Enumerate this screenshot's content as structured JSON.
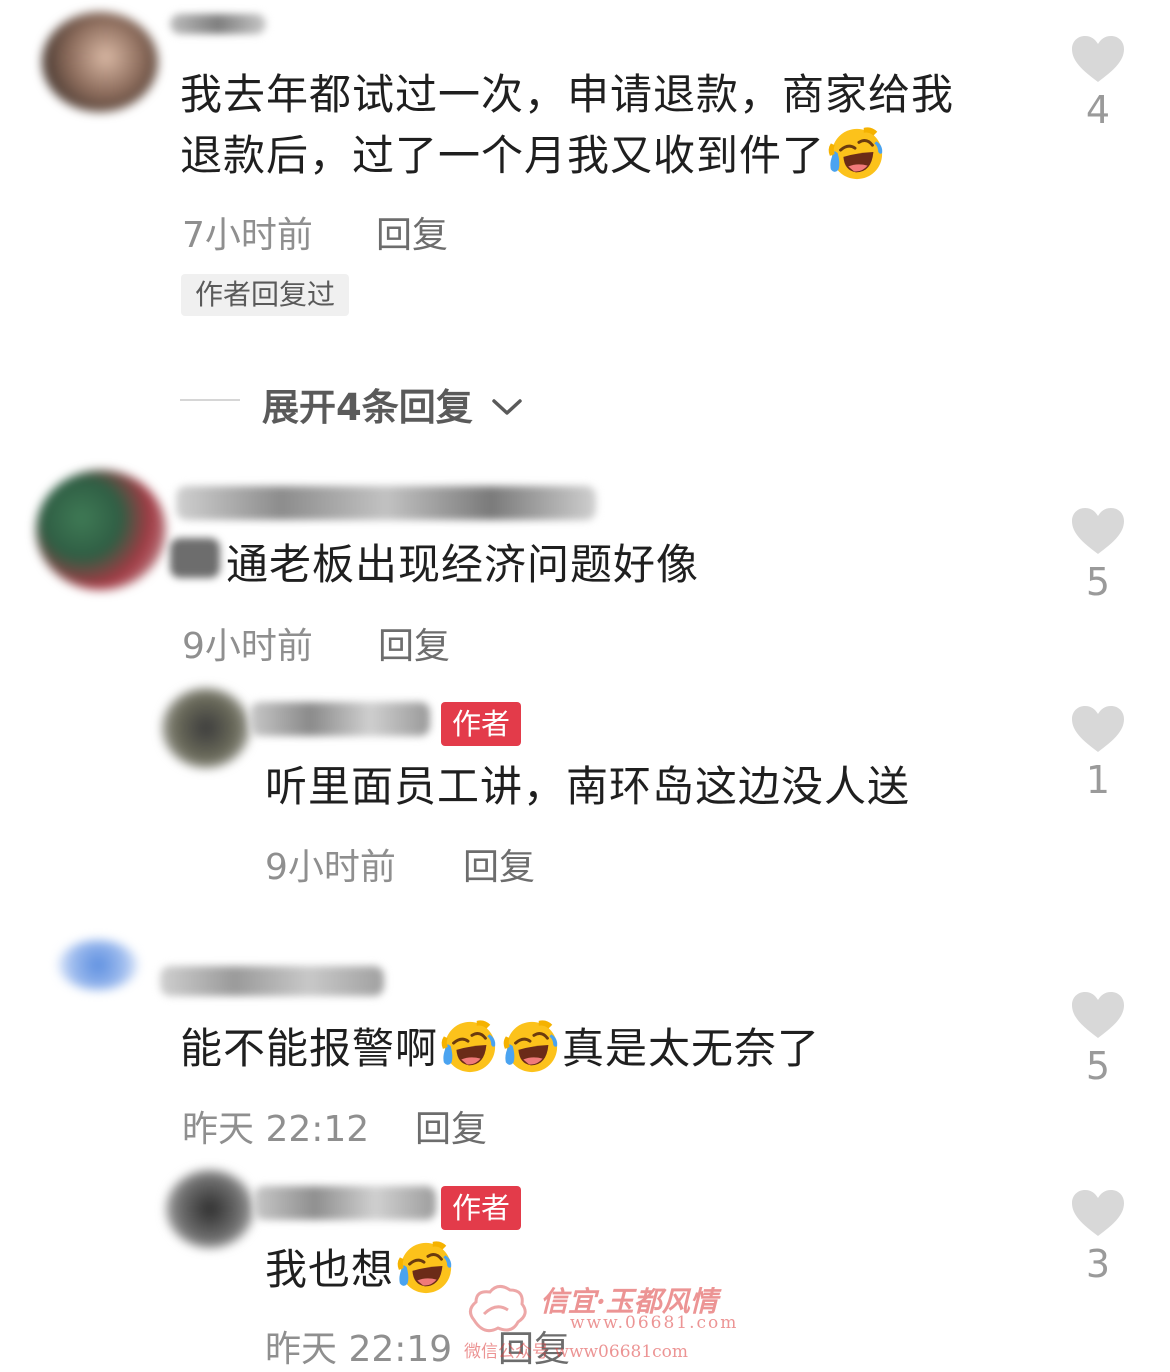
{
  "ui": {
    "reply_label": "回复",
    "author_replied_label": "作者回复过",
    "author_tag": "作者"
  },
  "colors": {
    "author_tag": "#e33b4a",
    "like_heart": "#d8d8d8",
    "meta_text": "#8f8f8f"
  },
  "comments": [
    {
      "line1": "我去年都试过一次，申请退款，商家给我",
      "line2": "退款后，过了一个月我又收到件了",
      "time": "7小时前",
      "likes": "4",
      "expand_replies": "展开4条回复"
    },
    {
      "text": "通老板出现经济问题好像",
      "time": "9小时前",
      "likes": "5",
      "author_reply": {
        "text": "听里面员工讲，南环岛这边没人送",
        "time": "9小时前",
        "likes": "1"
      }
    },
    {
      "text_a": "能不能报警啊",
      "text_b": "真是太无奈了",
      "time": "昨天 22:12",
      "likes": "5",
      "author_reply": {
        "text": "我也想",
        "time": "昨天 22:19",
        "likes": "3"
      }
    }
  ],
  "watermark": {
    "title": "信宜·玉都风情",
    "url": "www.06681.com",
    "sub": "微信公众号 www06681com"
  }
}
